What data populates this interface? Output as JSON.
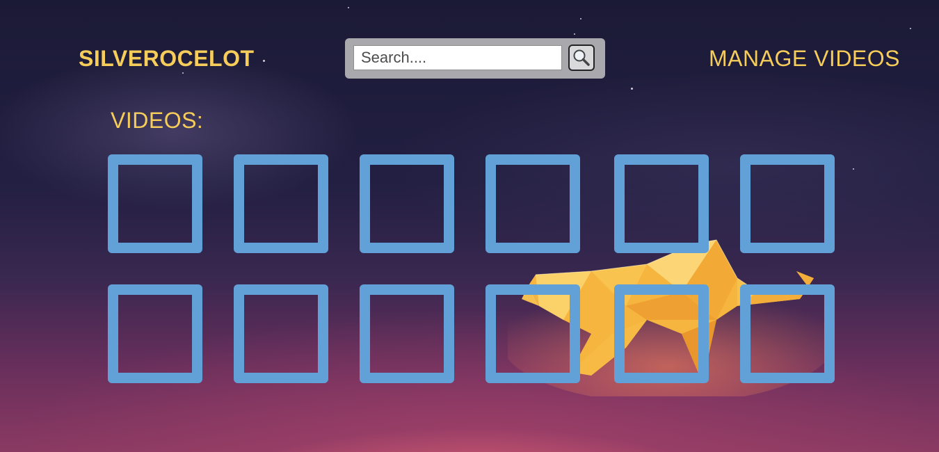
{
  "header": {
    "brand": "SILVEROCELOT",
    "manage_link": "MANAGE VIDEOS"
  },
  "search": {
    "placeholder": "Search....",
    "value": "",
    "button_icon": "magnifier-icon"
  },
  "videos": {
    "label": "VIDEOS:",
    "count": 12
  },
  "colors": {
    "accent": "#f6cd5a",
    "tile_border": "#62a1d8",
    "search_bg": "#a9a8ad"
  }
}
